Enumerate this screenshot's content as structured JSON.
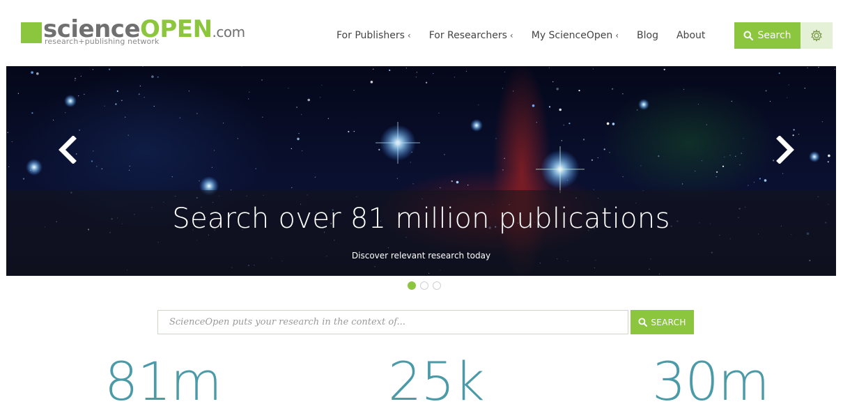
{
  "logo": {
    "word_gray": "science",
    "word_green": "OPEN",
    "word_suffix": ".com",
    "tagline": "research+publishing network"
  },
  "nav": {
    "items": [
      {
        "label": "For Publishers",
        "chevron": "‹"
      },
      {
        "label": "For Researchers",
        "chevron": "‹"
      },
      {
        "label": "My ScienceOpen",
        "chevron": "‹"
      },
      {
        "label": "Blog",
        "chevron": ""
      },
      {
        "label": "About",
        "chevron": ""
      }
    ],
    "search_label": "Search"
  },
  "hero": {
    "title": "Search over 81 million publications",
    "subtitle": "Discover relevant research today",
    "slides_total": 3,
    "active_slide": 1
  },
  "search": {
    "placeholder": "ScienceOpen puts your research in the context of...",
    "button_label": "SEARCH"
  },
  "stats": [
    {
      "value": "81m"
    },
    {
      "value": "25k"
    },
    {
      "value": "30m"
    }
  ],
  "colors": {
    "brand_green": "#8cc63f",
    "stat_teal": "#4a9aa8",
    "logo_gray": "#707070"
  },
  "icons": {
    "search": "search-icon",
    "settings": "settings-icon",
    "prev": "chevron-left-icon",
    "next": "chevron-right-icon"
  }
}
